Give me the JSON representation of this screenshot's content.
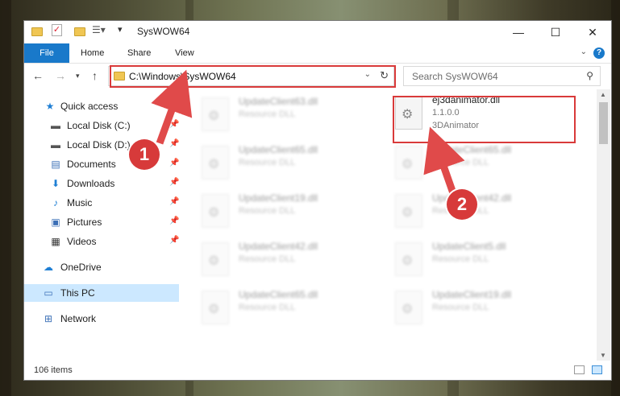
{
  "window": {
    "title": "SysWOW64",
    "minimize": "—",
    "maximize": "☐",
    "close": "✕"
  },
  "ribbon": {
    "tabs": [
      "File",
      "Home",
      "Share",
      "View"
    ],
    "help": "?"
  },
  "address": {
    "path": "C:\\Windows\\SysWOW64",
    "search_placeholder": "Search SysWOW64"
  },
  "sidebar": {
    "items": [
      {
        "label": "Quick access",
        "icon": "star-icon"
      },
      {
        "label": "Local Disk (C:)",
        "icon": "drive-icon",
        "pinned": true
      },
      {
        "label": "Local Disk (D:)",
        "icon": "drive-icon",
        "pinned": true
      },
      {
        "label": "Documents",
        "icon": "documents-icon",
        "pinned": true
      },
      {
        "label": "Downloads",
        "icon": "download-icon",
        "pinned": true
      },
      {
        "label": "Music",
        "icon": "music-icon",
        "pinned": true
      },
      {
        "label": "Pictures",
        "icon": "pictures-icon",
        "pinned": true
      },
      {
        "label": "Videos",
        "icon": "videos-icon",
        "pinned": true
      },
      {
        "label": "OneDrive",
        "icon": "cloud-icon"
      },
      {
        "label": "This PC",
        "icon": "computer-icon",
        "selected": true
      },
      {
        "label": "Network",
        "icon": "network-icon"
      }
    ]
  },
  "files": {
    "highlighted": {
      "name": "ej3danimator.dll",
      "line1": "1.1.0.0",
      "line2": "3DAnimator"
    },
    "left_column": [
      {
        "name": "UpdateClient63.dll",
        "type": "Resource DLL"
      },
      {
        "name": "UpdateClient65.dll",
        "type": "Resource DLL"
      },
      {
        "name": "UpdateClient19.dll",
        "type": "Resource DLL"
      },
      {
        "name": "UpdateClient42.dll",
        "type": "Resource DLL"
      },
      {
        "name": "UpdateClient65.dll",
        "type": "Resource DLL"
      }
    ],
    "right_column": [
      {
        "name": "UpdateClient65.dll",
        "type": "Resource DLL"
      },
      {
        "name": "UpdateClient42.dll",
        "type": "Resource DLL"
      },
      {
        "name": "UpdateClient5.dll",
        "type": "Resource DLL"
      },
      {
        "name": "UpdateClient19.dll",
        "type": "Resource DLL"
      }
    ]
  },
  "status": {
    "item_count": "106 items"
  },
  "callouts": [
    "1",
    "2"
  ],
  "colors": {
    "accent": "#1979ca",
    "highlight": "#d93a3a",
    "selected": "#cce8ff"
  }
}
